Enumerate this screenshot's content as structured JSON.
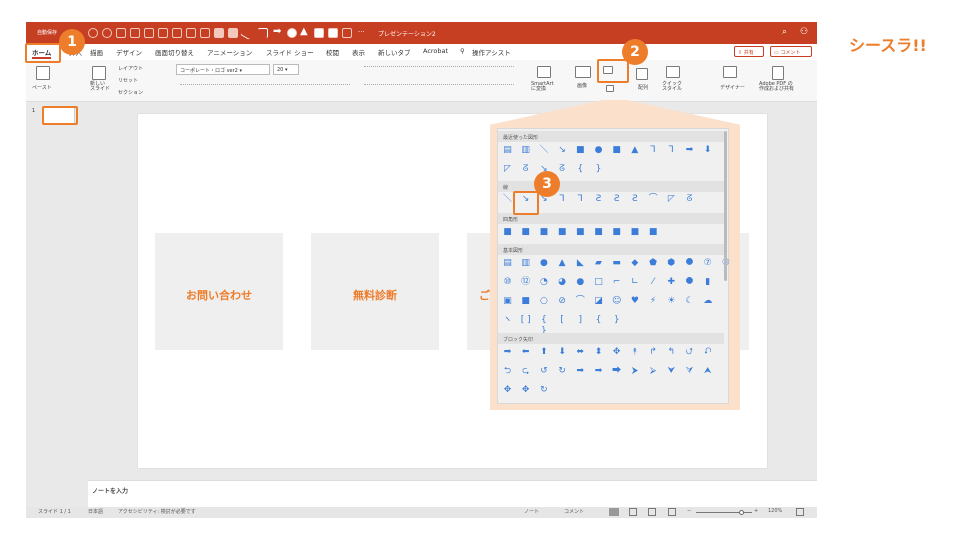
{
  "window": {
    "app_label": "自動保存",
    "doc_title": "プレゼンテーション2",
    "overflow": "···",
    "search_glyph": "⌕",
    "user_glyph": "⚇"
  },
  "tabs": [
    "ホーム",
    "挿入",
    "描画",
    "デザイン",
    "画面切り替え",
    "アニメーション",
    "スライド ショー",
    "校閲",
    "表示",
    "新しいタブ",
    "Acrobat",
    "操作アシスト"
  ],
  "share_label": "共有",
  "comment_label": "コメント",
  "ribbon": {
    "paste": "ペースト",
    "new_slide": "新しい\nスライド",
    "layout": "レイアウト",
    "reset": "リセット",
    "section": "セクション",
    "font_name": "コーポレート・ロゴ ver2",
    "font_size": "20",
    "image": "画像",
    "arrange": "配列",
    "quick_style": "クイック\nスタイル",
    "designer": "デザイナー",
    "adobe": "Adobe PDF の\n作成および共有",
    "smartart": "SmartArt\nに変換"
  },
  "thumbnail_number": "1",
  "slide_cards": [
    "お問い合わせ",
    "無料診断",
    "ご提"
  ],
  "notes_placeholder": "ノートを入力",
  "status": {
    "slide": "スライド 1 / 1",
    "language": "日本語",
    "accessibility": "アクセシビリティ: 検討が必要です",
    "notes": "ノート",
    "comments": "コメント",
    "zoom": "120%",
    "zoom_minus": "−",
    "zoom_plus": "+"
  },
  "shape_panel": {
    "recent": "最近使った図形",
    "lines": "線",
    "rectangles": "四角形",
    "basic": "基本図形",
    "arrows": "ブロック矢印",
    "recent_row1": [
      "▤",
      "▥",
      "＼",
      "↘",
      "■",
      "●",
      "■",
      "▲",
      "⅂",
      "⅂",
      "➡",
      "⬇"
    ],
    "recent_row2": [
      "◸",
      "ᘔ",
      "↘",
      "ᘔ",
      "{",
      "}"
    ],
    "lines_row": [
      "＼",
      "↘",
      "↘",
      "⅂",
      "⅂",
      "Ꙅ",
      "Ꙅ",
      "Ꙅ",
      "⌒",
      "◸",
      "ᘔ"
    ],
    "rect_row": [
      "■",
      "■",
      "■",
      "■",
      "■",
      "■",
      "■",
      "■",
      "■"
    ],
    "basic_row1": [
      "▤",
      "▥",
      "●",
      "▲",
      "◣",
      "▰",
      "▬",
      "◆",
      "⬟",
      "⬢",
      "⯃",
      "⑦",
      "⑧"
    ],
    "basic_row2": [
      "⑩",
      "⑫",
      "◔",
      "◕",
      "●",
      "□",
      "⌐",
      "∟",
      "⁄",
      "✚",
      "⯃",
      "▮"
    ],
    "basic_row3": [
      "▣",
      "■",
      "○",
      "⊘",
      "⌒",
      "◪",
      "☺",
      "♥",
      "⚡",
      "☀",
      "☾",
      "☁"
    ],
    "basic_row4": [
      "ヽ",
      "[ ]",
      "{ }",
      "[",
      "]",
      "{",
      "}"
    ],
    "arrow_row1": [
      "➡",
      "⬅",
      "⬆",
      "⬇",
      "⬌",
      "⬍",
      "✥",
      "⯭",
      "↱",
      "↰",
      "⮍",
      "⮏"
    ],
    "arrow_row2": [
      "⮌",
      "⮎",
      "↺",
      "↻",
      "➡",
      "➡",
      "⮕",
      "⮞",
      "⮚",
      "⮟",
      "⮛",
      "⮝"
    ],
    "arrow_row3": [
      "✥",
      "✥",
      "↻"
    ]
  },
  "badges": [
    "1",
    "2",
    "3"
  ],
  "brand": "シースラ!!",
  "colors": {
    "titlebar": "#c63f22",
    "accent": "#ee7d2b",
    "shape": "#3b7dd8"
  }
}
